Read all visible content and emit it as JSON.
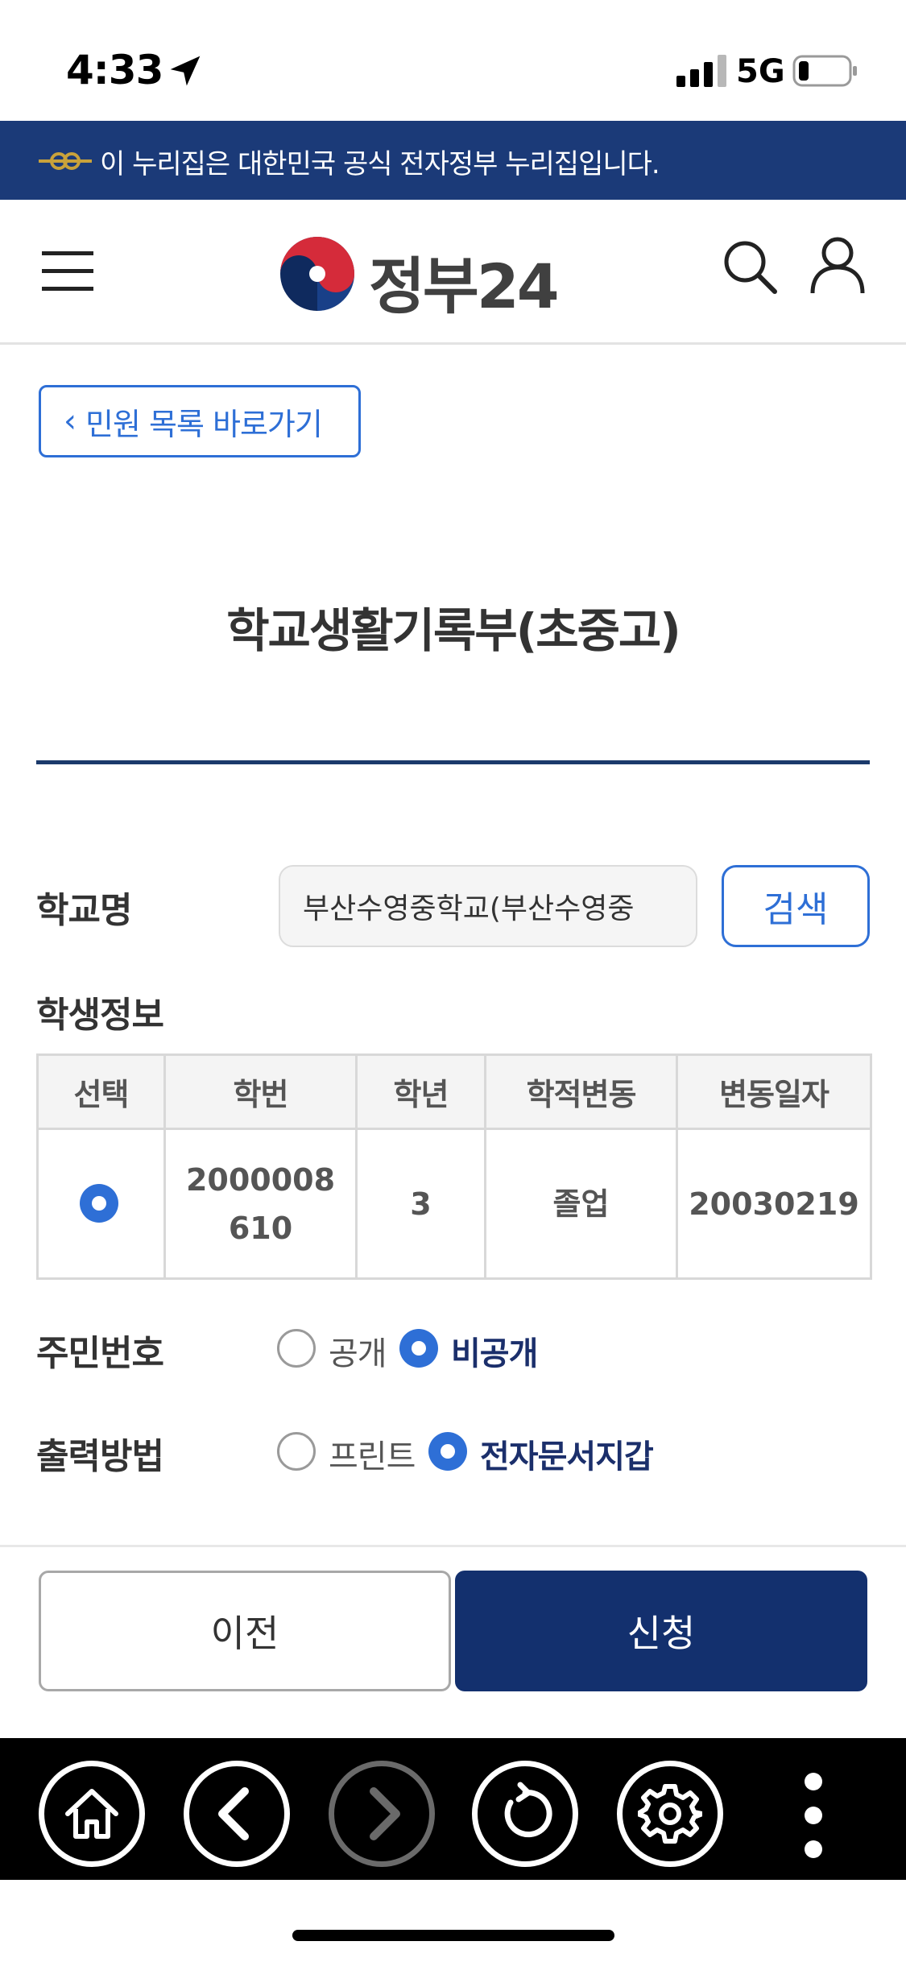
{
  "status_bar": {
    "time": "4:33",
    "network": "5G"
  },
  "banner": {
    "text": "이 누리집은 대한민국 공식 전자정부 누리집입니다."
  },
  "header": {
    "logo_text": "정부24"
  },
  "back_link": {
    "label": "민원 목록 바로가기"
  },
  "page": {
    "title": "학교생활기록부(초중고)"
  },
  "form": {
    "school_label": "학교명",
    "school_value": "부산수영중학교(부산수영중",
    "search_label": "검색",
    "student_label": "학생정보",
    "table": {
      "headers": [
        "선택",
        "학번",
        "학년",
        "학적변동",
        "변동일자"
      ],
      "rows": [
        {
          "selected": true,
          "student_no": "2000008610",
          "grade": "3",
          "status": "졸업",
          "date": "20030219"
        }
      ]
    },
    "resident_label": "주민번호",
    "resident_options": [
      {
        "label": "공개",
        "selected": false
      },
      {
        "label": "비공개",
        "selected": true
      }
    ],
    "output_label": "출력방법",
    "output_options": [
      {
        "label": "프린트",
        "selected": false
      },
      {
        "label": "전자문서지갑",
        "selected": true
      }
    ]
  },
  "actions": {
    "prev_label": "이전",
    "apply_label": "신청"
  },
  "colors": {
    "navy": "#13306e",
    "banner": "#1b3a78",
    "accent_blue": "#2e6fd6"
  },
  "toolbar": {
    "icons": [
      "home-icon",
      "back-icon",
      "forward-icon",
      "reload-icon",
      "settings-icon",
      "more-icon"
    ]
  }
}
